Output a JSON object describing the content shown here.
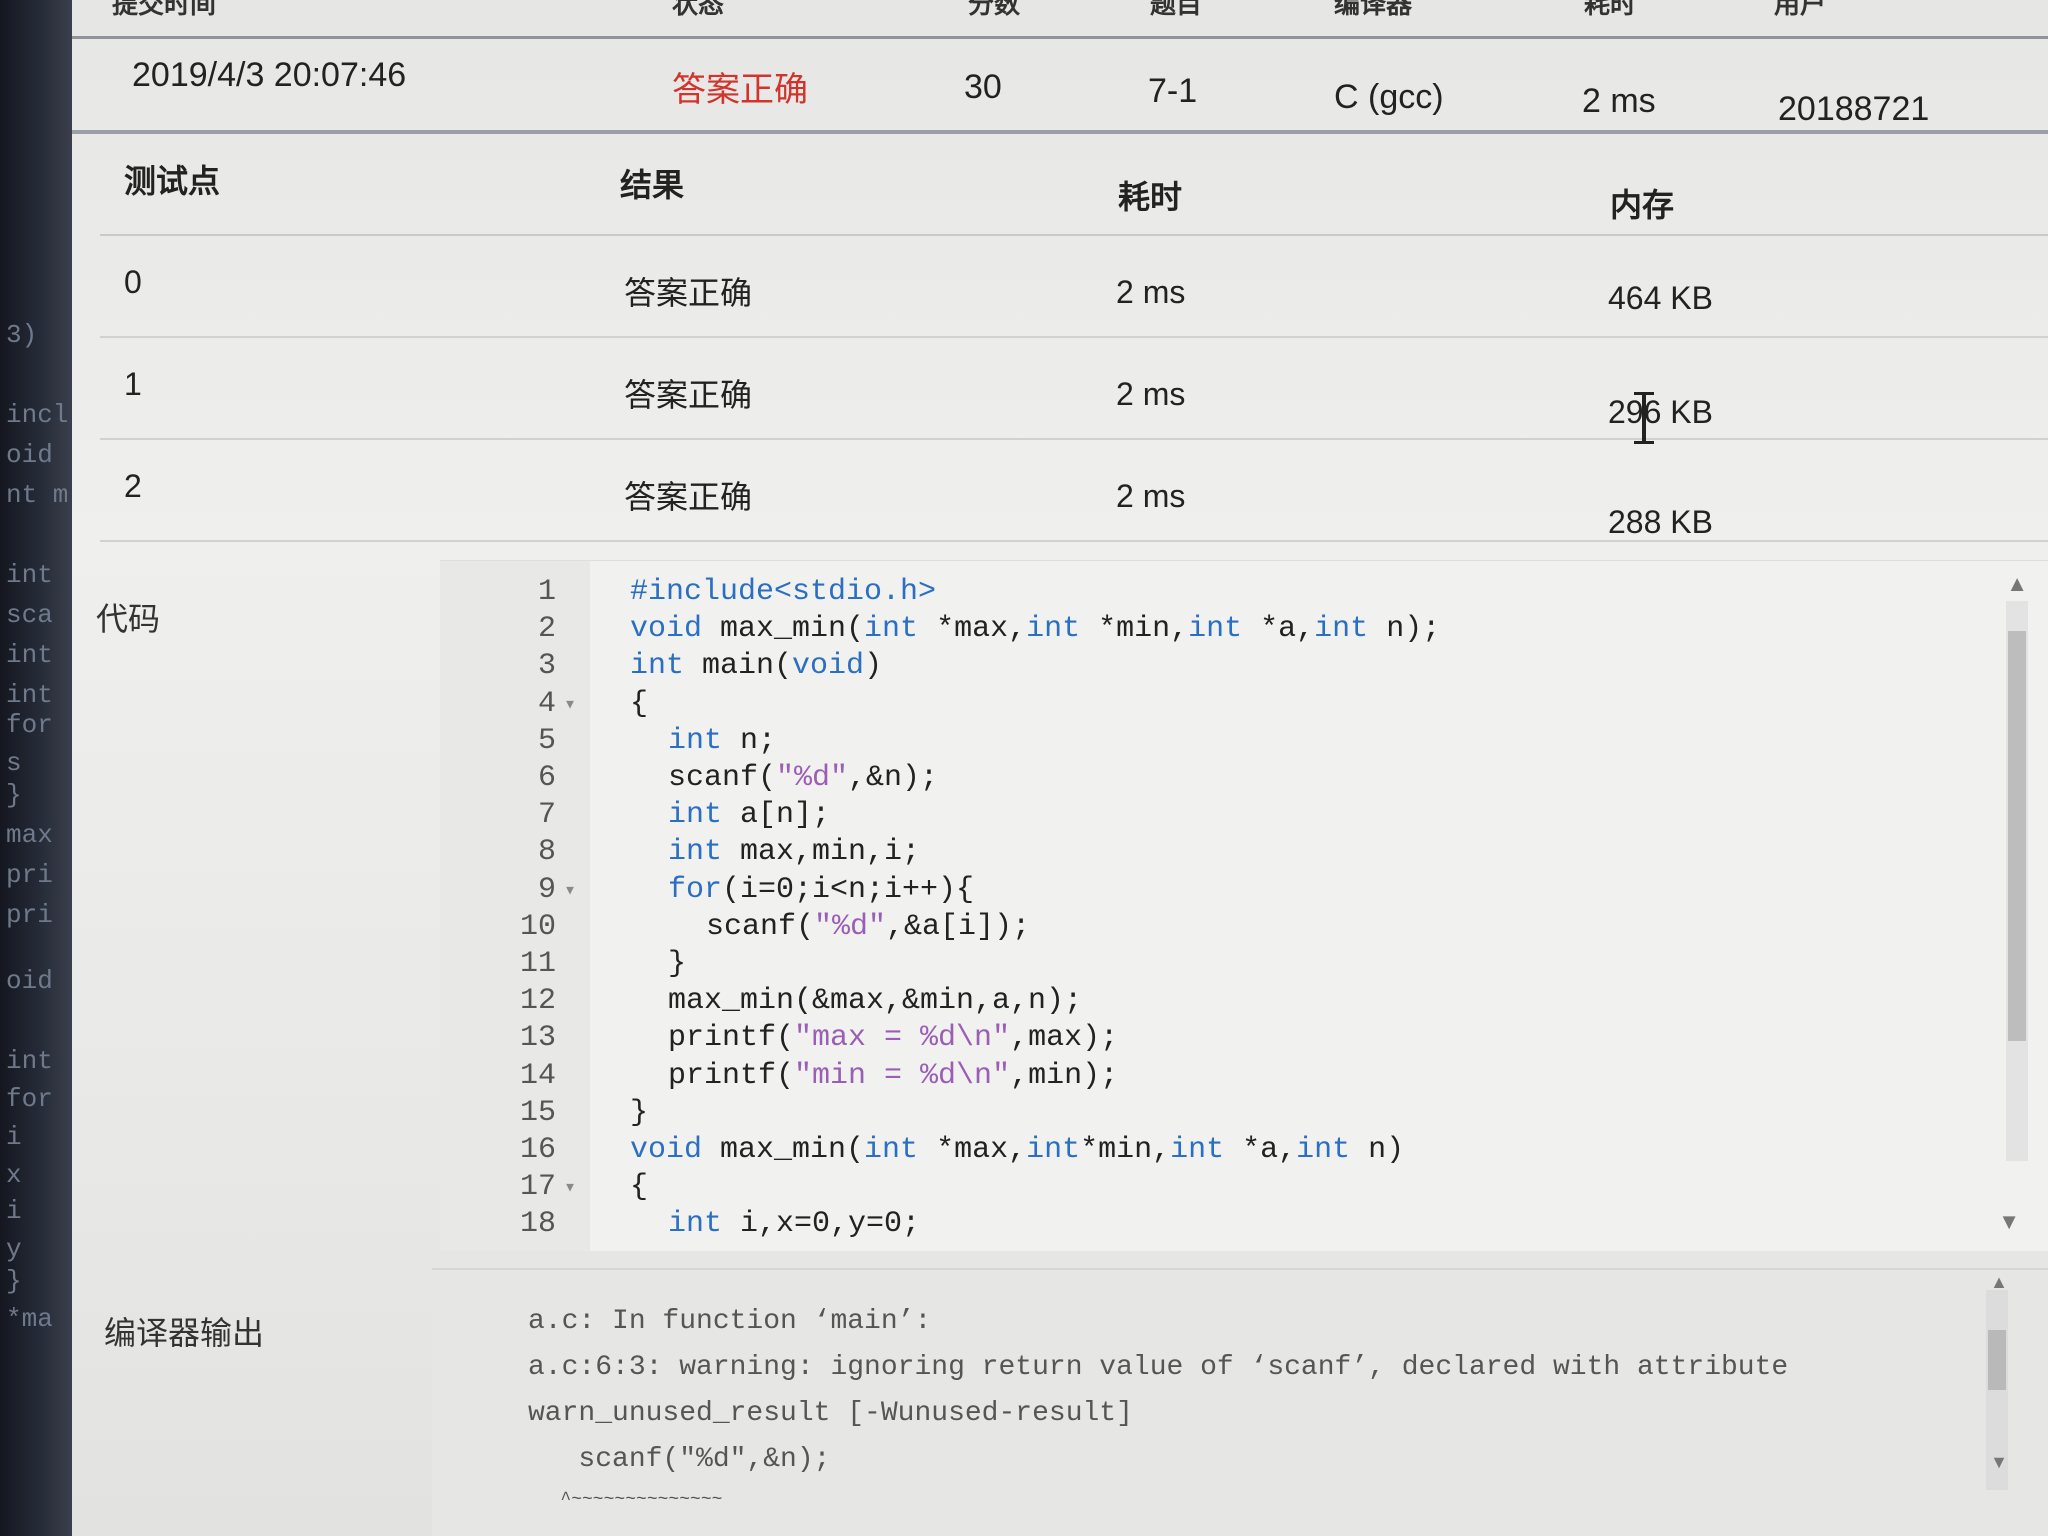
{
  "left_strip": [
    "3)",
    "incl",
    "oid",
    "nt m",
    "int",
    "sca",
    "int",
    "int",
    "for",
    "s",
    "}",
    "max",
    "pri",
    "pri",
    "oid",
    "int",
    "for",
    "i",
    "x",
    "i",
    "y",
    "}",
    "*ma"
  ],
  "top_header": [
    "提交时间",
    "状态",
    "分数",
    "题目",
    "编译器",
    "耗时",
    "用户"
  ],
  "submission": {
    "time": "2019/4/3 20:07:46",
    "status": "答案正确",
    "score": "30",
    "problem": "7-1",
    "compiler": "C (gcc)",
    "duration": "2 ms",
    "user": "20188721"
  },
  "testcases": {
    "headers": [
      "测试点",
      "结果",
      "耗时",
      "内存"
    ],
    "rows": [
      {
        "id": "0",
        "result": "答案正确",
        "time": "2 ms",
        "memory": "464 KB"
      },
      {
        "id": "1",
        "result": "答案正确",
        "time": "2 ms",
        "memory": "296 KB"
      },
      {
        "id": "2",
        "result": "答案正确",
        "time": "2 ms",
        "memory": "288 KB"
      }
    ]
  },
  "code_label": "代码",
  "code": [
    {
      "n": "1",
      "fold": "",
      "indent": 0,
      "tokens": [
        [
          "kw",
          "#include<stdio.h>"
        ]
      ]
    },
    {
      "n": "2",
      "fold": "",
      "indent": 0,
      "tokens": [
        [
          "kw",
          "void"
        ],
        [
          "plain",
          " max_min("
        ],
        [
          "kw",
          "int"
        ],
        [
          "plain",
          " *max,"
        ],
        [
          "kw",
          "int"
        ],
        [
          "plain",
          " *min,"
        ],
        [
          "kw",
          "int"
        ],
        [
          "plain",
          " *a,"
        ],
        [
          "kw",
          "int"
        ],
        [
          "plain",
          " n);"
        ]
      ]
    },
    {
      "n": "3",
      "fold": "",
      "indent": 0,
      "tokens": [
        [
          "kw",
          "int"
        ],
        [
          "plain",
          " main("
        ],
        [
          "kw",
          "void"
        ],
        [
          "plain",
          ")"
        ]
      ]
    },
    {
      "n": "4",
      "fold": "▾",
      "indent": 0,
      "tokens": [
        [
          "plain",
          "{"
        ]
      ]
    },
    {
      "n": "5",
      "fold": "",
      "indent": 1,
      "tokens": [
        [
          "kw",
          "int"
        ],
        [
          "plain",
          " n;"
        ]
      ]
    },
    {
      "n": "6",
      "fold": "",
      "indent": 1,
      "tokens": [
        [
          "plain",
          "scanf("
        ],
        [
          "str",
          "\"%d\""
        ],
        [
          "plain",
          ",&n);"
        ]
      ]
    },
    {
      "n": "7",
      "fold": "",
      "indent": 1,
      "tokens": [
        [
          "kw",
          "int"
        ],
        [
          "plain",
          " a[n];"
        ]
      ]
    },
    {
      "n": "8",
      "fold": "",
      "indent": 1,
      "tokens": [
        [
          "kw",
          "int"
        ],
        [
          "plain",
          " max,min,i;"
        ]
      ]
    },
    {
      "n": "9",
      "fold": "▾",
      "indent": 1,
      "tokens": [
        [
          "kw",
          "for"
        ],
        [
          "plain",
          "(i=0;i<n;i++){"
        ]
      ]
    },
    {
      "n": "10",
      "fold": "",
      "indent": 2,
      "tokens": [
        [
          "plain",
          "scanf("
        ],
        [
          "str",
          "\"%d\""
        ],
        [
          "plain",
          ",&a[i]);"
        ]
      ]
    },
    {
      "n": "11",
      "fold": "",
      "indent": 1,
      "tokens": [
        [
          "plain",
          "}"
        ]
      ]
    },
    {
      "n": "12",
      "fold": "",
      "indent": 1,
      "tokens": [
        [
          "plain",
          "max_min(&max,&min,a,n);"
        ]
      ]
    },
    {
      "n": "13",
      "fold": "",
      "indent": 1,
      "tokens": [
        [
          "plain",
          "printf("
        ],
        [
          "str",
          "\"max = %d\\n\""
        ],
        [
          "plain",
          ",max);"
        ]
      ]
    },
    {
      "n": "14",
      "fold": "",
      "indent": 1,
      "tokens": [
        [
          "plain",
          "printf("
        ],
        [
          "str",
          "\"min = %d\\n\""
        ],
        [
          "plain",
          ",min);"
        ]
      ]
    },
    {
      "n": "15",
      "fold": "",
      "indent": 0,
      "tokens": [
        [
          "plain",
          "}"
        ]
      ]
    },
    {
      "n": "16",
      "fold": "",
      "indent": 0,
      "tokens": [
        [
          "kw",
          "void"
        ],
        [
          "plain",
          " max_min("
        ],
        [
          "kw",
          "int"
        ],
        [
          "plain",
          " *max,"
        ],
        [
          "kw",
          "int"
        ],
        [
          "plain",
          "*min,"
        ],
        [
          "kw",
          "int"
        ],
        [
          "plain",
          " *a,"
        ],
        [
          "kw",
          "int"
        ],
        [
          "plain",
          " n)"
        ]
      ]
    },
    {
      "n": "17",
      "fold": "▾",
      "indent": 0,
      "tokens": [
        [
          "plain",
          "{"
        ]
      ]
    },
    {
      "n": "18",
      "fold": "",
      "indent": 1,
      "tokens": [
        [
          "kw",
          "int"
        ],
        [
          "plain",
          " i,x=0,y=0;"
        ]
      ]
    }
  ],
  "compiler_output_label": "编译器输出",
  "compiler_output": [
    "a.c: In function ‘main’:",
    "a.c:6:3: warning: ignoring return value of ‘scanf’, declared with attribute",
    "warn_unused_result [-Wunused-result]",
    "   scanf(\"%d\",&n);",
    "   ^~~~~~~~~~~~~~~"
  ],
  "colors": {
    "accepted": "#d0342c",
    "keyword": "#2b6fc2",
    "string": "#9a5fb5"
  }
}
